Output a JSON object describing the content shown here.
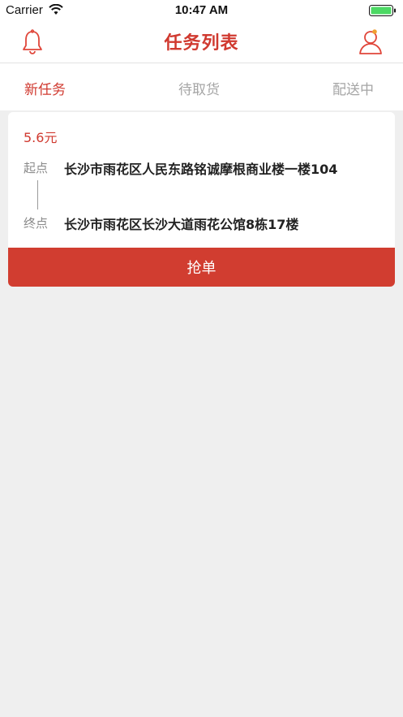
{
  "status_bar": {
    "carrier": "Carrier",
    "time": "10:47 AM",
    "wifi_icon": "wifi-icon",
    "battery_icon": "battery-icon"
  },
  "header": {
    "title": "任务列表",
    "left_icon": "bell-icon",
    "right_icon": "user-icon",
    "accent_color": "#d0392f"
  },
  "tabs": [
    {
      "label": "新任务",
      "active": true
    },
    {
      "label": "待取货",
      "active": false
    },
    {
      "label": "配送中",
      "active": false
    }
  ],
  "tasks": [
    {
      "price": "5.6元",
      "start_label": "起点",
      "start_address": "长沙市雨花区人民东路铭诚摩根商业楼一楼104",
      "end_label": "终点",
      "end_address": "长沙市雨花区长沙大道雨花公馆8栋17楼",
      "action_label": "抢单",
      "action_color": "#d13d30"
    }
  ]
}
